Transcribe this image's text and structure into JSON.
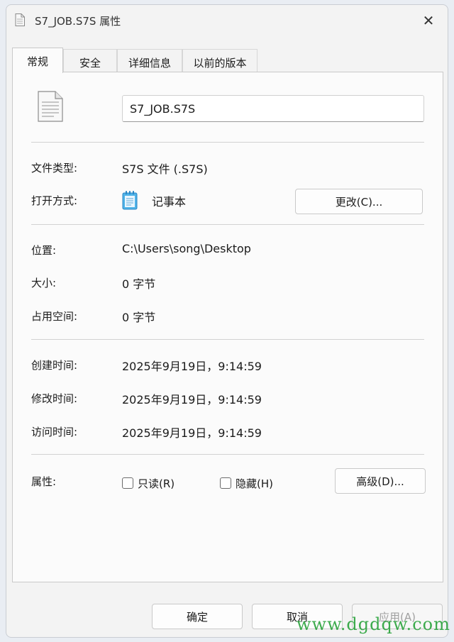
{
  "window": {
    "title": "S7_JOB.S7S 属性",
    "close_glyph": "✕"
  },
  "tabs": [
    {
      "label": "常规",
      "active": true
    },
    {
      "label": "安全",
      "active": false
    },
    {
      "label": "详细信息",
      "active": false
    },
    {
      "label": "以前的版本",
      "active": false
    }
  ],
  "general": {
    "file_name": "S7_JOB.S7S",
    "file_type_label": "文件类型:",
    "file_type_value": "S7S 文件 (.S7S)",
    "open_with_label": "打开方式:",
    "open_with_value": "记事本",
    "change_button": "更改(C)...",
    "location_label": "位置:",
    "location_value": "C:\\Users\\song\\Desktop",
    "size_label": "大小:",
    "size_value": "0 字节",
    "size_on_disk_label": "占用空间:",
    "size_on_disk_value": "0 字节",
    "created_label": "创建时间:",
    "created_value": "2025年9月19日，9:14:59",
    "modified_label": "修改时间:",
    "modified_value": "2025年9月19日，9:14:59",
    "accessed_label": "访问时间:",
    "accessed_value": "2025年9月19日，9:14:59",
    "attributes_label": "属性:",
    "readonly_label": "只读(R)",
    "hidden_label": "隐藏(H)",
    "advanced_button": "高级(D)..."
  },
  "footer": {
    "ok": "确定",
    "cancel": "取消",
    "apply": "应用(A)"
  },
  "watermark": "www.dgdqw.com",
  "icons": {
    "title": "document-icon",
    "file": "document-icon",
    "open_with": "notepad-icon"
  }
}
